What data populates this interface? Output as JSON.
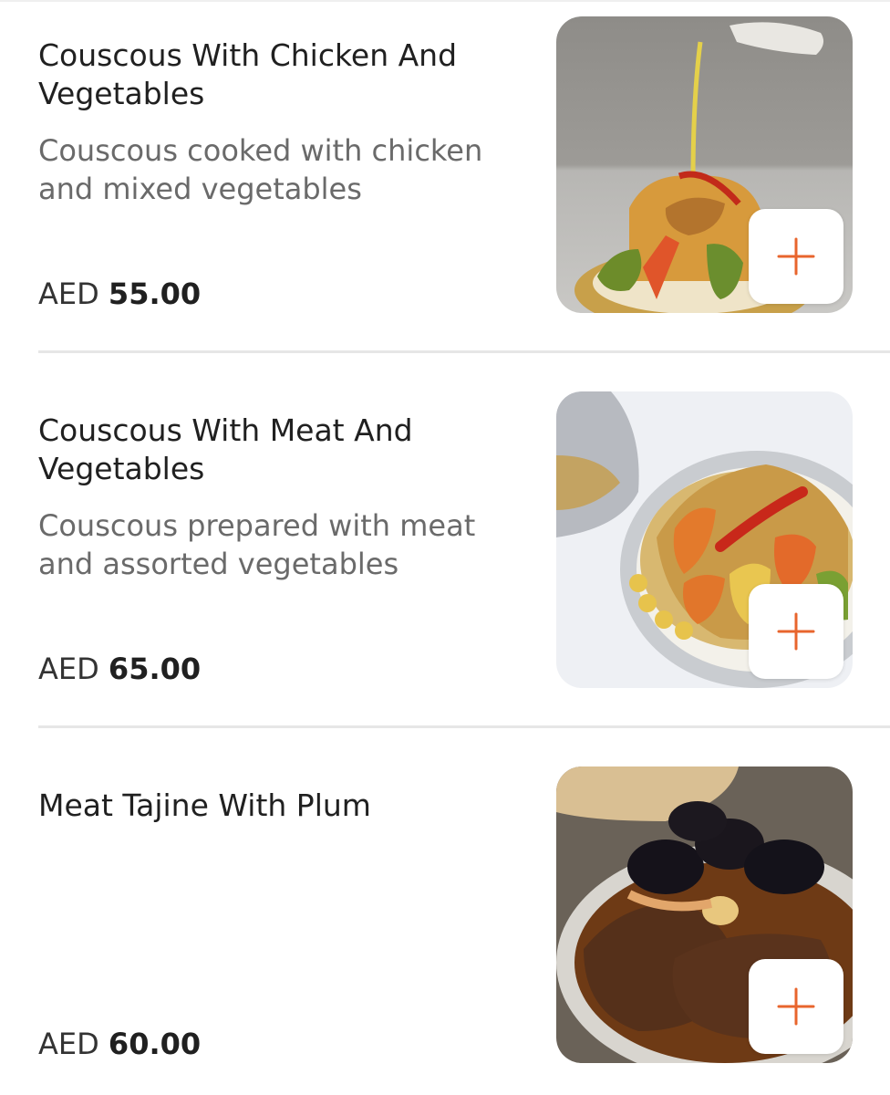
{
  "accent_color": "#e8652d",
  "menu": {
    "items": [
      {
        "title": "Couscous With Chicken And Vegetables",
        "description": "Couscous cooked with chicken and mixed vegetables",
        "currency": "AED",
        "price": "55.00",
        "add_icon": "plus-icon"
      },
      {
        "title": "Couscous With Meat And Vegetables",
        "description": "Couscous prepared with meat and assorted vegetables",
        "currency": "AED",
        "price": "65.00",
        "add_icon": "plus-icon"
      },
      {
        "title": "Meat Tajine With Plum",
        "description": "",
        "currency": "AED",
        "price": "60.00",
        "add_icon": "plus-icon"
      }
    ]
  }
}
